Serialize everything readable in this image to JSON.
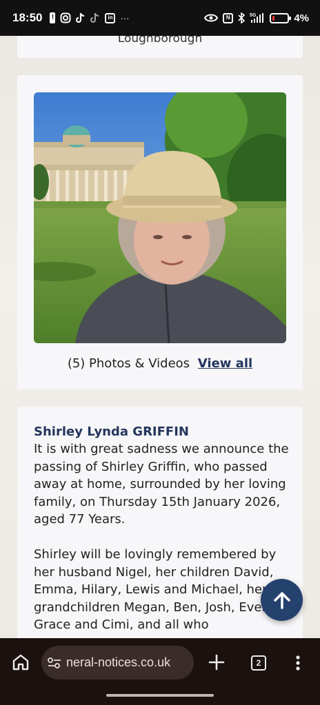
{
  "status_bar": {
    "time": "18:50",
    "battery": "4%",
    "network": "5G",
    "icons": [
      "alert-icon",
      "instagram-icon",
      "tiktok-icon",
      "tiktok-icon",
      "linkedin-icon",
      "more-icon",
      "eye-icon",
      "nfc-icon",
      "bluetooth-icon",
      "signal-icon",
      "battery-icon"
    ],
    "more": "···"
  },
  "top_card": {
    "location": "Loughborough"
  },
  "photo_card": {
    "photo_alt": "Woman in a straw hat in front of a domed building",
    "count_text": "(5) Photos & Videos",
    "view_all": "View all"
  },
  "notice": {
    "name": "Shirley Lynda GRIFFIN",
    "paragraphs": [
      "It is with great sadness we announce the passing of Shirley Griffin, who passed away at home, surrounded by her loving family, on Thursday 15th January 2026, aged 77 Years.",
      "Shirley will be lovingly remembered by her husband Nigel, her children David, Emma, Hilary, Lewis and Michael, her grandchildren Megan, Ben, Josh, Evelyn, Grace and Cimi, and all who"
    ]
  },
  "fab": {
    "icon": "arrow-up-icon"
  },
  "browser": {
    "url": "neral-notices.co.uk",
    "tab_count": "2",
    "colors": {
      "bar": "#1b1210",
      "pill": "#3a2c28"
    }
  },
  "colors": {
    "accent": "#24365c",
    "fab": "#25416e"
  }
}
